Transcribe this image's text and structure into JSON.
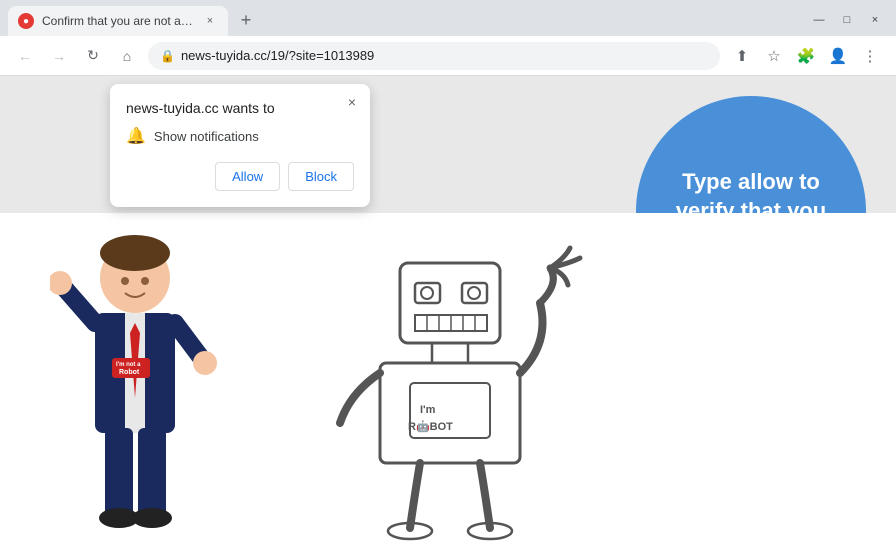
{
  "browser": {
    "tab": {
      "favicon_text": "★",
      "title": "Confirm that you are not a robot",
      "close_label": "×"
    },
    "new_tab_label": "+",
    "window_controls": {
      "minimize": "—",
      "maximize": "□",
      "close": "×"
    },
    "nav": {
      "back": "←",
      "forward": "→",
      "reload": "↻",
      "home": "⌂"
    },
    "address": {
      "lock_icon": "🔒",
      "url": "news-tuyida.cc/19/?site=1013989"
    },
    "toolbar": {
      "share_icon": "⬆",
      "bookmark_icon": "☆",
      "extensions_icon": "🧩",
      "profile_icon": "👤",
      "menu_icon": "⋮"
    }
  },
  "notification_popup": {
    "site_wants_to": "news-tuyida.cc wants to",
    "close_label": "×",
    "bell_icon": "🔔",
    "notification_text": "Show notifications",
    "allow_label": "Allow",
    "block_label": "Block"
  },
  "page": {
    "circle_text": "Type allow to verify that you are not robot.",
    "background_color": "#e8e8e8",
    "circle_color": "#4a90d9"
  }
}
